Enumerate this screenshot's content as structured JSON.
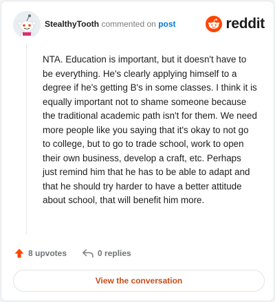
{
  "header": {
    "username": "StealthyTooth",
    "action_text": "commented on",
    "post_link": "post",
    "brand": "reddit"
  },
  "comment": {
    "text": "NTA. Education is important, but it doesn't have to be everything. He's clearly applying himself to a degree if he's getting B's in some classes. I think it is equally important not to shame someone because the traditional academic path isn't for them. We need more people like you saying that it's okay to not go to college, but to go to trade school, work to open their own business, develop a craft, etc. Perhaps just remind him that he has to be able to adapt and that he should try harder to have a better attitude about school, that will benefit him more."
  },
  "actions": {
    "upvotes": "8 upvotes",
    "replies": "0 replies"
  },
  "cta": {
    "label": "View the conversation"
  },
  "colors": {
    "reddit_orange": "#ff4500",
    "link_blue": "#0079d3",
    "cta_text": "#c84c1a"
  }
}
